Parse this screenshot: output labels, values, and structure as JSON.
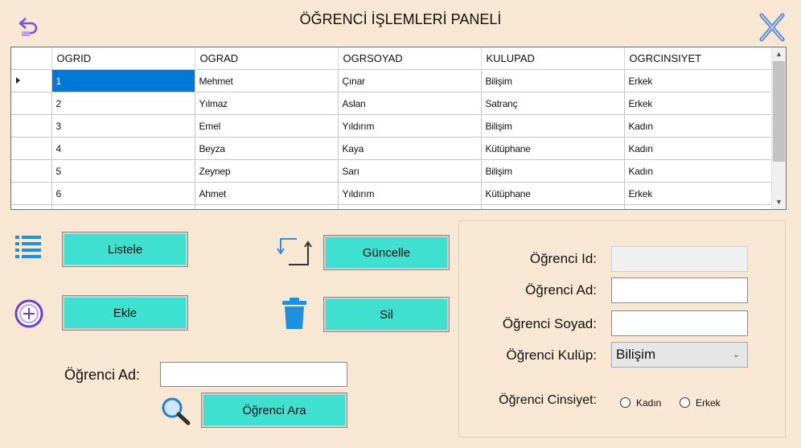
{
  "window": {
    "title": "ÖĞRENCİ İŞLEMLERİ PANELİ"
  },
  "icons": {
    "back": "back-arrow-icon",
    "close": "close-x-icon",
    "list": "list-icon",
    "add": "plus-circle-icon",
    "update": "swap-arrows-icon",
    "delete": "trash-icon",
    "search": "magnifier-icon"
  },
  "colors": {
    "background": "#f8e7d3",
    "button": "#40e0d0",
    "selection": "#0078d7"
  },
  "grid": {
    "columns": [
      "OGRID",
      "OGRAD",
      "OGRSOYAD",
      "KULUPAD",
      "OGRCINSIYET"
    ],
    "rows": [
      [
        "1",
        "Mehmet",
        "Çınar",
        "Bilişim",
        "Erkek"
      ],
      [
        "2",
        "Yılmaz",
        "Aslan",
        "Satranç",
        "Erkek"
      ],
      [
        "3",
        "Emel",
        "Yıldırım",
        "Bilişim",
        "Kadın"
      ],
      [
        "4",
        "Beyza",
        "Kaya",
        "Kütüphane",
        "Kadın"
      ],
      [
        "5",
        "Zeynep",
        "Sarı",
        "Bilişim",
        "Kadın"
      ],
      [
        "6",
        "Ahmet",
        "Yıldırım",
        "Kütüphane",
        "Erkek"
      ]
    ],
    "selected_row": 0
  },
  "buttons": {
    "list": "Listele",
    "add": "Ekle",
    "update": "Güncelle",
    "delete": "Sil",
    "search": "Öğrenci Ara"
  },
  "search": {
    "label": "Öğrenci Ad:",
    "value": ""
  },
  "form": {
    "id_label": "Öğrenci Id:",
    "id_value": "",
    "name_label": "Öğrenci Ad:",
    "name_value": "",
    "surname_label": "Öğrenci Soyad:",
    "surname_value": "",
    "club_label": "Öğrenci Kulüp:",
    "club_value": "Bilişim",
    "gender_label": "Öğrenci Cinsiyet:",
    "gender_female": "Kadın",
    "gender_male": "Erkek"
  }
}
